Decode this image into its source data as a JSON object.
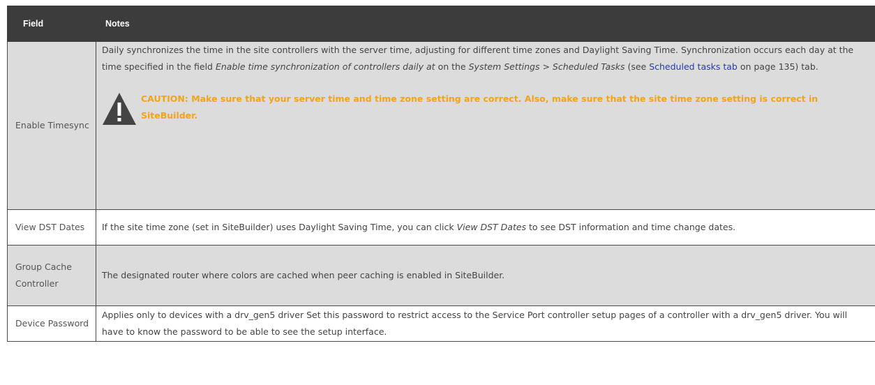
{
  "table": {
    "headers": {
      "field": "Field",
      "notes": "Notes"
    },
    "rows": [
      {
        "field": "Enable Timesync",
        "notes": {
          "part1": "Daily synchronizes the time in the site controllers with the server time, adjusting for different time zones and Daylight Saving Time. Synchronization occurs each day at the time specified in the field ",
          "em1": "Enable time synchronization of controllers daily at",
          "part2": " on the ",
          "em2": "System Settings > Scheduled Tasks",
          "part3": " (see ",
          "link": "Scheduled tasks tab",
          "part4": " on page 135) tab."
        },
        "caution": "CAUTION: Make sure that your server time and time zone setting are correct. Also, make sure that the site time zone setting is correct in SiteBuilder."
      },
      {
        "field": "View DST Dates",
        "notes": {
          "part1": "If the site time zone (set in SiteBuilder) uses Daylight Saving Time, you can click ",
          "em1": "View DST Dates",
          "part2": " to see DST information and time change dates."
        }
      },
      {
        "field": "Group Cache Controller",
        "notes": {
          "part1": "The designated router where colors are cached when peer caching is enabled in SiteBuilder."
        }
      },
      {
        "field": "Device Password",
        "notes": {
          "part1": "Applies only to devices with a drv_gen5 driver Set this password to restrict access to the Service Port controller setup pages of a controller with a drv_gen5 driver. You will have to know the password to be able to see the setup interface."
        }
      }
    ]
  },
  "colors": {
    "header_bg": "#3c3c3c",
    "shaded_row": "#dcdcdc",
    "caution_text": "#f2a516",
    "link": "#2436c8"
  },
  "icons": {
    "caution": "warning-triangle-icon"
  }
}
